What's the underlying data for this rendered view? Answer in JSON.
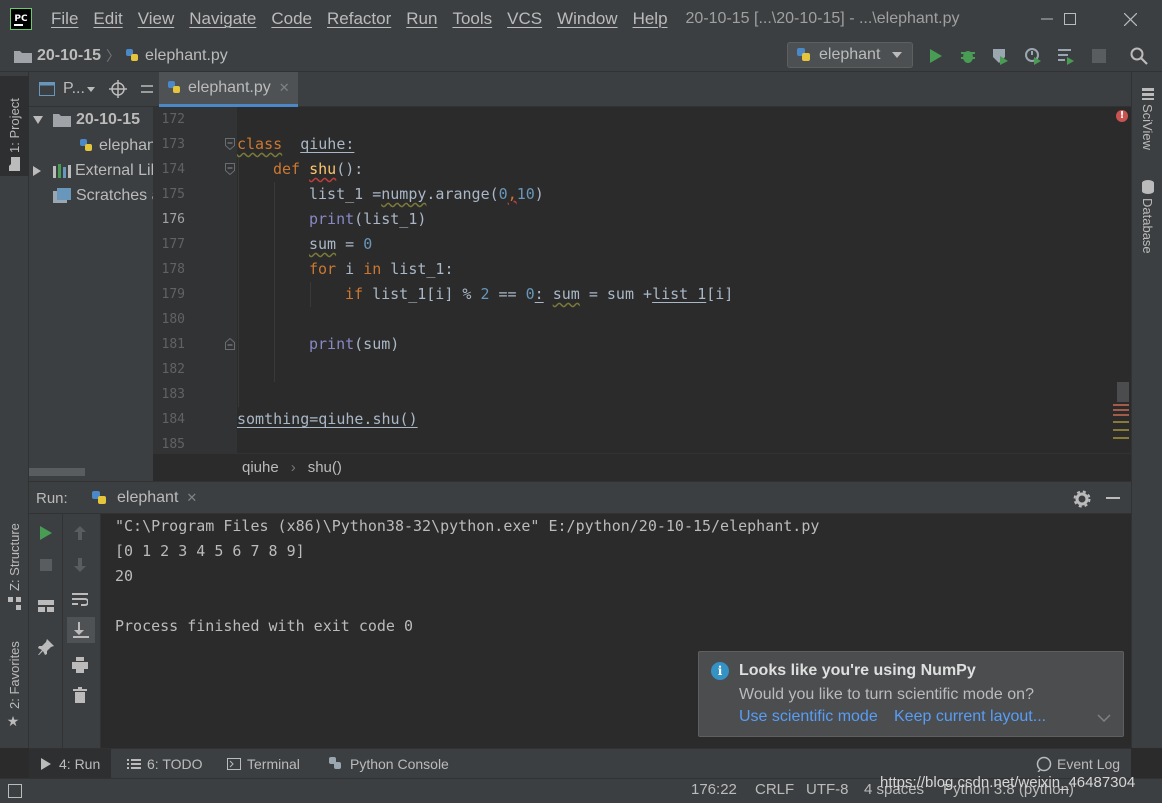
{
  "title_bar": {
    "app_logo": "PC",
    "menu": [
      "File",
      "Edit",
      "View",
      "Navigate",
      "Code",
      "Refactor",
      "Run",
      "Tools",
      "VCS",
      "Window",
      "Help"
    ],
    "window_title": "20-10-15 [...\\20-10-15] - ...\\elephant.py"
  },
  "nav_bar": {
    "breadcrumb": [
      "20-10-15",
      "elephant.py"
    ],
    "run_config": "elephant"
  },
  "left_stripe": {
    "project": "1: Project",
    "structure": "Z: Structure",
    "favorites": "2: Favorites"
  },
  "right_stripe": {
    "sciview": "SciView",
    "database": "Database"
  },
  "project_panel": {
    "header": "P...",
    "tree": [
      "20-10-15",
      "elephant.py",
      "External Libraries",
      "Scratches and Consoles"
    ]
  },
  "editor": {
    "tab": "elephant.py",
    "current_line": "176",
    "line_numbers": [
      "172",
      "173",
      "174",
      "175",
      "176",
      "177",
      "178",
      "179",
      "180",
      "181",
      "182",
      "183",
      "184",
      "185"
    ],
    "code": {
      "l173_kw": "class",
      "l173_name": "qiuhe:",
      "l174_kw": "def",
      "l174_fn": "shu",
      "l174_rest": "():",
      "l175_a": "list_1 =",
      "l175_b": "numpy",
      "l175_c": ".arange(",
      "l175_d": "0",
      "l175_e": ",",
      "l175_f": "10",
      "l175_g": ")",
      "l176_bi": "print",
      "l176_rest": "(list_1)",
      "l177_a": "sum",
      "l177_b": " = ",
      "l177_c": "0",
      "l178_kw1": "for",
      "l178_a": " i ",
      "l178_kw2": "in",
      "l178_b": " list_1:",
      "l179_kw": "if",
      "l179_a": " list_1[i] % ",
      "l179_n1": "2",
      "l179_b": " == ",
      "l179_n2": "0",
      "l179_c": ":",
      "l179_d": " ",
      "l179_e": "sum",
      "l179_f": " = sum +",
      "l179_g": "list_1",
      "l179_h": "[i]",
      "l181_bi": "print",
      "l181_rest": "(sum)",
      "l184_a": "somthing",
      "l184_b": "=qiuhe.shu()"
    },
    "breadcrumb": [
      "qiuhe",
      "shu()"
    ]
  },
  "run_panel": {
    "label": "Run:",
    "tab": "elephant",
    "console": [
      "\"C:\\Program Files (x86)\\Python38-32\\python.exe\" E:/python/20-10-15/elephant.py",
      "[0 1 2 3 4 5 6 7 8 9]",
      "20",
      "",
      "Process finished with exit code 0"
    ]
  },
  "notification": {
    "title": "Looks like you're using NumPy",
    "body": "Would you like to turn scientific mode on?",
    "action_primary": "Use scientific mode",
    "action_secondary": "Keep current layout..."
  },
  "bottom_tabs": [
    "4: Run",
    "6: TODO",
    "Terminal",
    "Python Console",
    "Event Log"
  ],
  "status_bar": {
    "position": "176:22",
    "line_sep": "CRLF",
    "encoding": "UTF-8",
    "indent": "4 spaces",
    "interpreter": "Python 3.8 (python)",
    "watermark": "https://blog.csdn.net/weixin_46487304"
  },
  "colors": {
    "accent": "#4a88c7",
    "keyword": "#cc7832",
    "function": "#ffc66d",
    "number": "#6897bb",
    "builtin": "#8888c6",
    "run_green": "#499c54"
  }
}
